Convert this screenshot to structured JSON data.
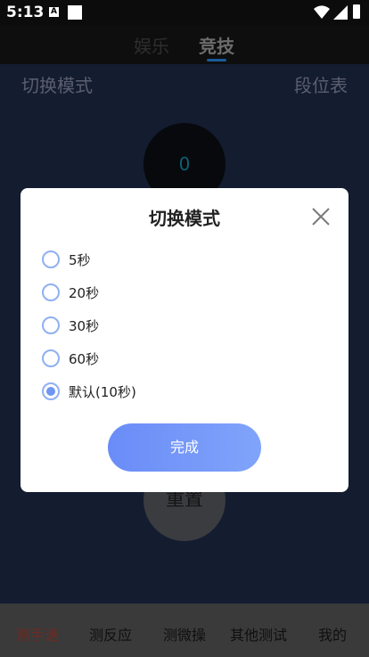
{
  "status_bar": {
    "time": "5:13",
    "a_badge": "A"
  },
  "top_tabs": [
    "娱乐",
    "竞技"
  ],
  "header": {
    "mode_label": "切换模式",
    "rank_label": "段位表"
  },
  "counter": {
    "value": "0"
  },
  "reset_label": "重置",
  "bottom_nav": [
    "测手速",
    "测反应",
    "测微操",
    "其他测试",
    "我的"
  ],
  "dialog": {
    "title": "切换模式",
    "options": [
      "5秒",
      "20秒",
      "30秒",
      "60秒",
      "默认(10秒)"
    ],
    "selected_option": "默认(10秒)",
    "confirm_label": "完成"
  },
  "colors": {
    "accent": "#6f96f0",
    "radio_border": "#8fb0f2",
    "active_nav": "#6e2a22"
  },
  "icons": [
    "wifi-icon",
    "signal-icon",
    "battery-icon",
    "close-icon"
  ]
}
